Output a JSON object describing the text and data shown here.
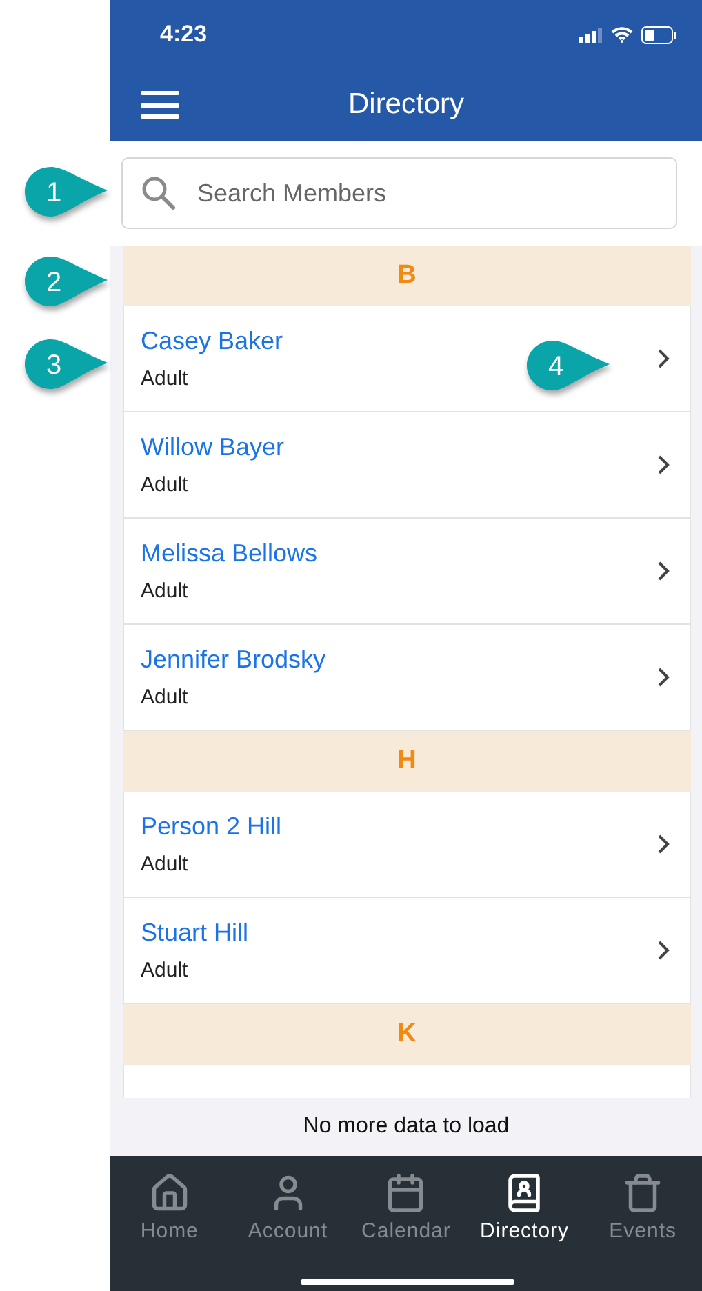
{
  "status_bar": {
    "time": "4:23"
  },
  "header": {
    "title": "Directory"
  },
  "search": {
    "placeholder": "Search Members"
  },
  "sections": [
    {
      "letter": "B",
      "members": [
        {
          "name": "Casey Baker",
          "role": "Adult"
        },
        {
          "name": "Willow Bayer",
          "role": "Adult"
        },
        {
          "name": "Melissa Bellows",
          "role": "Adult"
        },
        {
          "name": "Jennifer Brodsky",
          "role": "Adult"
        }
      ]
    },
    {
      "letter": "H",
      "members": [
        {
          "name": "Person 2 Hill",
          "role": "Adult"
        },
        {
          "name": "Stuart Hill",
          "role": "Adult"
        }
      ]
    },
    {
      "letter": "K",
      "cut_off_row": true
    }
  ],
  "footer": "No more data to load",
  "tabs": [
    {
      "label": "Home",
      "selected": false
    },
    {
      "label": "Account",
      "selected": false
    },
    {
      "label": "Calendar",
      "selected": false
    },
    {
      "label": "Directory",
      "selected": true
    },
    {
      "label": "Events",
      "selected": false
    }
  ],
  "callouts": [
    "1",
    "2",
    "3",
    "4"
  ]
}
